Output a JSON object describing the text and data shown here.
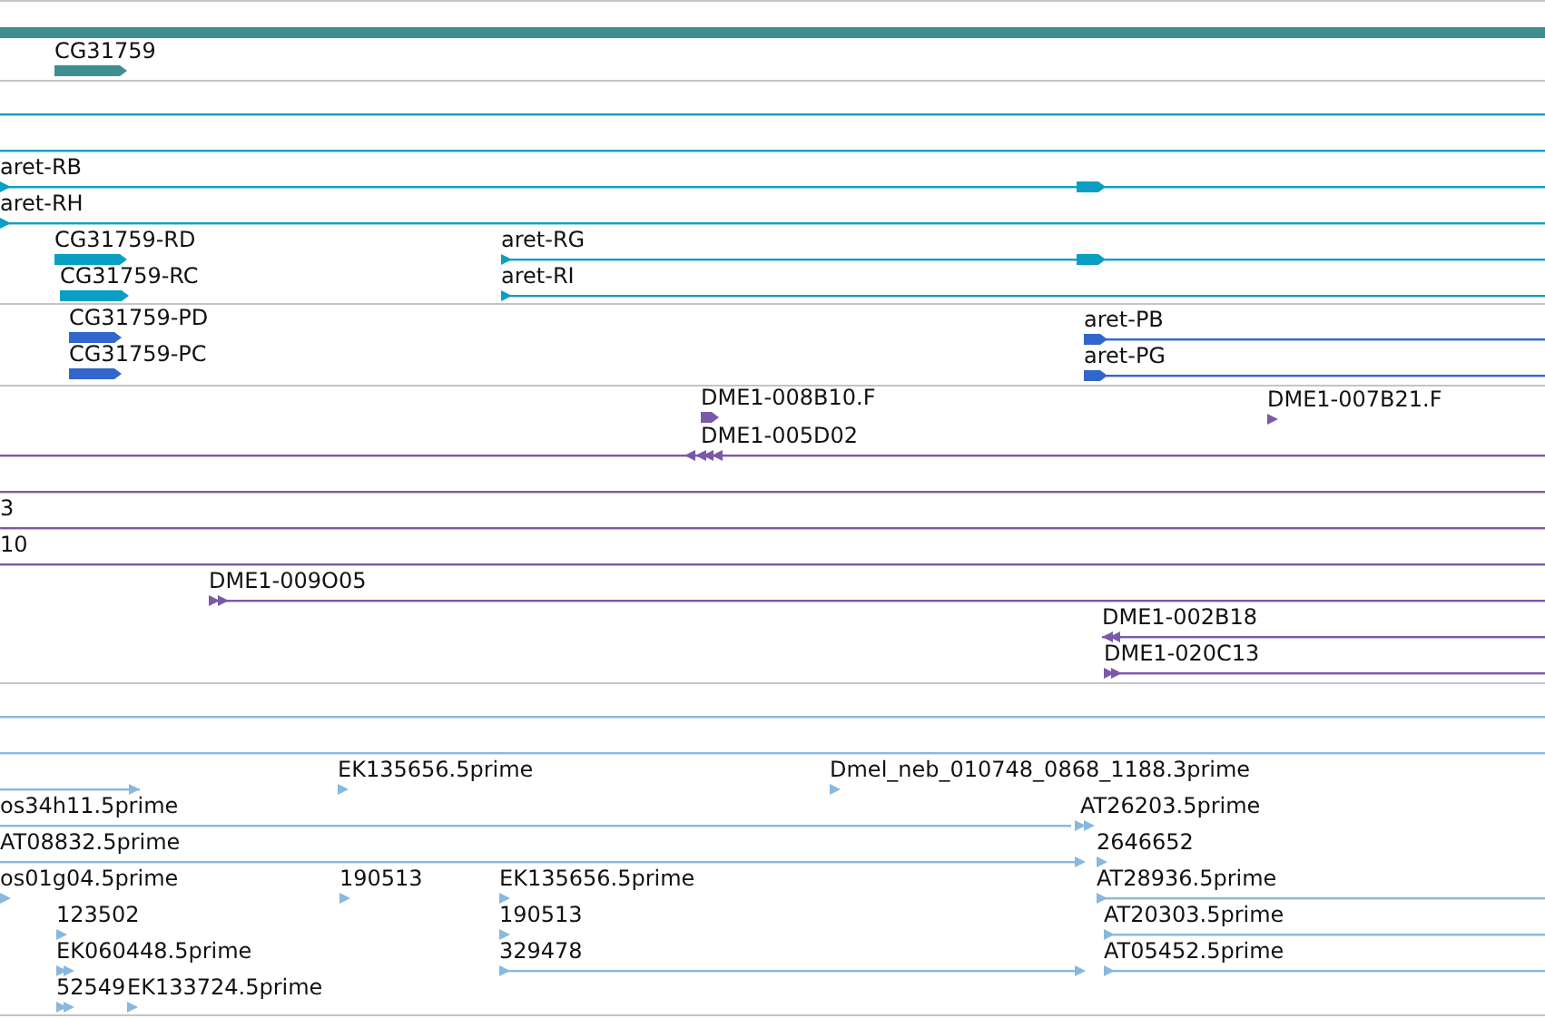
{
  "tracks": [
    {
      "features": [
        {
          "label": "CG31759",
          "reverse": false
        }
      ]
    },
    {
      "features": [
        {
          "label": "aret-RB",
          "reverse": false
        },
        {
          "label": "aret-RH",
          "reverse": false
        },
        {
          "label": "CG31759-RD",
          "reverse": false
        },
        {
          "label": "aret-RG",
          "reverse": false
        },
        {
          "label": "CG31759-RC",
          "reverse": false
        },
        {
          "label": "aret-RI",
          "reverse": false
        }
      ]
    },
    {
      "features": [
        {
          "label": "CG31759-PD",
          "reverse": false
        },
        {
          "label": "CG31759-PC",
          "reverse": false
        },
        {
          "label": "aret-PB",
          "reverse": false
        },
        {
          "label": "aret-PG",
          "reverse": false
        }
      ]
    },
    {
      "features": [
        {
          "label": "DME1-008B10.F",
          "reverse": false
        },
        {
          "label": "DME1-007B21.F",
          "reverse": false
        },
        {
          "label": "DME1-005D02",
          "reverse": true
        },
        {
          "label": "3"
        },
        {
          "label": "10"
        },
        {
          "label": "DME1-009O05",
          "reverse": false
        },
        {
          "label": "DME1-002B18",
          "reverse": true
        },
        {
          "label": "DME1-020C13",
          "reverse": false
        }
      ]
    },
    {
      "features": [
        {
          "label": "EK135656.5prime",
          "reverse": false
        },
        {
          "label": "Dmel_neb_010748_0868_1188.3prime",
          "reverse": false
        },
        {
          "label": "os34h11.5prime"
        },
        {
          "label": "AT26203.5prime",
          "reverse": false
        },
        {
          "label": "AT08832.5prime",
          "reverse": false
        },
        {
          "label": "2646652",
          "reverse": false
        },
        {
          "label": "os01g04.5prime",
          "reverse": false
        },
        {
          "label": "190513",
          "reverse": false
        },
        {
          "label": "EK135656.5prime",
          "reverse": false
        },
        {
          "label": "AT28936.5prime",
          "reverse": false
        },
        {
          "label": "123502",
          "reverse": false
        },
        {
          "label": "190513",
          "reverse": false
        },
        {
          "label": "AT20303.5prime",
          "reverse": false
        },
        {
          "label": "EK060448.5prime",
          "reverse": false
        },
        {
          "label": "329478",
          "reverse": false
        },
        {
          "label": "AT05452.5prime",
          "reverse": false
        },
        {
          "label": "52549",
          "reverse": false
        },
        {
          "label": "EK133724.5prime",
          "reverse": false
        }
      ]
    }
  ]
}
